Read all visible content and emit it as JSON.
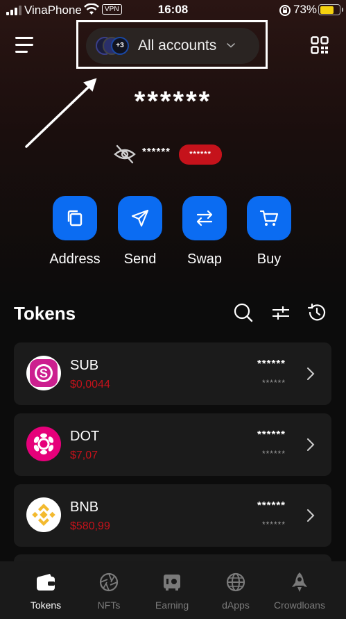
{
  "status_bar": {
    "carrier": "VinaPhone",
    "vpn": "VPN",
    "time": "16:08",
    "battery": "73%",
    "battery_level": 0.73,
    "battery_color": "#f5d20f"
  },
  "header": {
    "accounts_label": "All accounts",
    "avatar_badge": "+3"
  },
  "balance": {
    "total": "******",
    "sub": "******",
    "change_badge": "******"
  },
  "actions": [
    {
      "label": "Address",
      "icon": "copy-icon"
    },
    {
      "label": "Send",
      "icon": "send-icon"
    },
    {
      "label": "Swap",
      "icon": "swap-icon"
    },
    {
      "label": "Buy",
      "icon": "cart-icon"
    }
  ],
  "tokens_section": {
    "title": "Tokens",
    "icons": [
      "search-icon",
      "filter-icon",
      "history-icon"
    ]
  },
  "tokens": [
    {
      "symbol": "SUB",
      "price": "$0,0044",
      "amount": "******",
      "value": "******",
      "logo_color": "#cc1f8f"
    },
    {
      "symbol": "DOT",
      "price": "$7,07",
      "amount": "******",
      "value": "******",
      "logo_color": "#e6007a"
    },
    {
      "symbol": "BNB",
      "price": "$580,99",
      "amount": "******",
      "value": "******",
      "logo_color": "#f3ba2f"
    }
  ],
  "bottom_nav": [
    {
      "label": "Tokens",
      "icon": "wallet-icon",
      "active": true
    },
    {
      "label": "NFTs",
      "icon": "aperture-icon",
      "active": false
    },
    {
      "label": "Earning",
      "icon": "safe-icon",
      "active": false
    },
    {
      "label": "dApps",
      "icon": "globe-icon",
      "active": false
    },
    {
      "label": "Crowdloans",
      "icon": "rocket-icon",
      "active": false
    }
  ],
  "colors": {
    "accent_blue": "#0b6cf2",
    "negative_red": "#c5121b",
    "card_bg": "#1b1b1b"
  }
}
